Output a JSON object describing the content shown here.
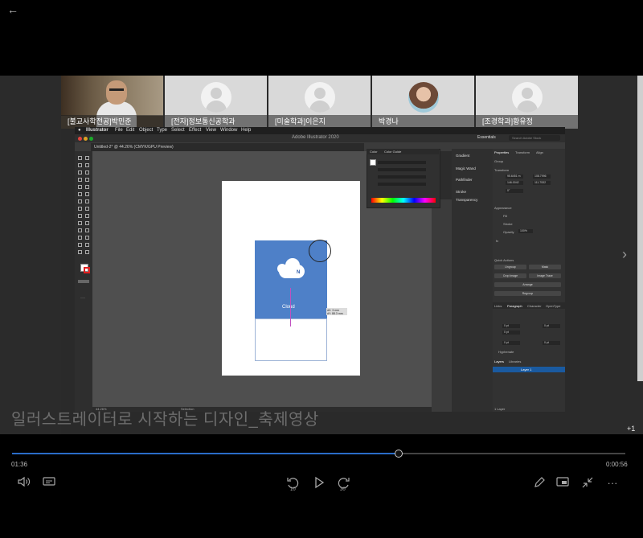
{
  "participants": [
    {
      "name": "[불교사학전공]박민준",
      "video": "camera"
    },
    {
      "name": "[전자]정보통신공학과",
      "video": "placeholder"
    },
    {
      "name": "[미술학과]이은지",
      "video": "placeholder"
    },
    {
      "name": "박경나",
      "video": "photo"
    },
    {
      "name": "[조경학과]황유정",
      "video": "placeholder"
    }
  ],
  "overflow_count": "+1",
  "illustrator": {
    "app_menu": [
      "Illustrator",
      "File",
      "Edit",
      "Object",
      "Type",
      "Select",
      "Effect",
      "View",
      "Window",
      "Help"
    ],
    "window_title": "Adobe Illustrator 2020",
    "workspace": "Essentials",
    "search_placeholder": "Search Adobe Stock",
    "doc_tab": "Untitled-2* @ 44.26% (CMYK/GPU Preview)",
    "color_tabs": [
      "Color",
      "Color Guide"
    ],
    "logo_badge": "N",
    "logo_text": "Cloud",
    "measure": "dX: 3 mm\ndY: 88.3 mm",
    "zoom": "44.26%",
    "status_tool": "Selection",
    "mid_panels": [
      "Gradient",
      "Magic Wand",
      "Pathfinder",
      "Stroke",
      "Transparency"
    ],
    "props_tabs": [
      "Properties",
      "Transform",
      "Align"
    ],
    "props": {
      "group": "Group",
      "transform": "Transform",
      "x": "95.6451 m",
      "y": "146.0042",
      "w": "108.7996",
      "h": "111.7532",
      "angle": "0°",
      "appearance": "Appearance",
      "fill": "Fill",
      "stroke": "Stroke",
      "opacity": "Opacity",
      "opacity_value": "100%",
      "fx": "fx",
      "quick_actions": "Quick Actions",
      "btn_ungroup": "Ungroup",
      "btn_mask": "Mask",
      "btn_crop": "Crop Image",
      "btn_trace": "Image Trace",
      "btn_arrange": "Arrange",
      "btn_regroup": "Regroup"
    },
    "char_tabs": [
      "Links",
      "Paragraph",
      "Character",
      "OpenType"
    ],
    "para_fields": [
      "0 pt",
      "0 pt",
      "0 pt",
      "0 pt",
      "0 pt"
    ],
    "hyphenate": "Hyphenate",
    "layer_tabs": [
      "Layers",
      "Libraries"
    ],
    "layer_name": "Layer 1",
    "layer_count": "1 Layer"
  },
  "subtitle": "일러스트레이터로 시작하는 디자인_축제영상",
  "player": {
    "time_current": "01:36",
    "time_remaining": "0:00:56",
    "progress": 0.63,
    "skip_back": "10",
    "skip_forward": "30"
  }
}
